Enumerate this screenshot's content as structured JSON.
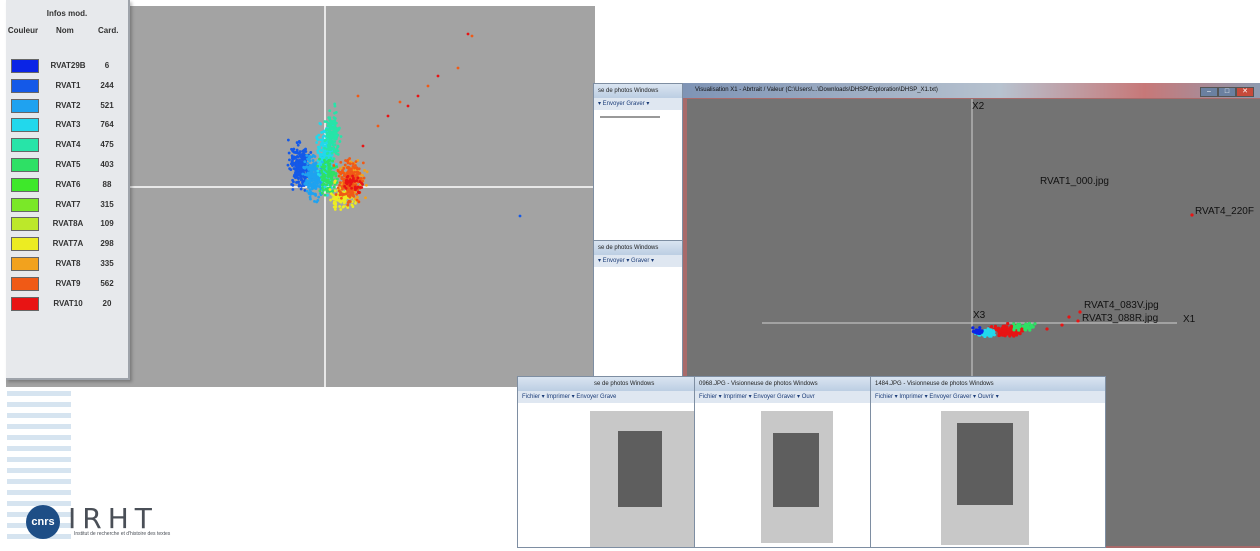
{
  "legend": {
    "title": "Infos mod.",
    "headers": {
      "color": "Couleur",
      "name": "Nom",
      "card": "Card."
    },
    "rows": [
      {
        "color": "#0a24e6",
        "name": "RVAT29B",
        "card": "6"
      },
      {
        "color": "#1459e8",
        "name": "RVAT1",
        "card": "244"
      },
      {
        "color": "#1fa2f0",
        "name": "RVAT2",
        "card": "521"
      },
      {
        "color": "#22d8ec",
        "name": "RVAT3",
        "card": "764"
      },
      {
        "color": "#27e4a8",
        "name": "RVAT4",
        "card": "475"
      },
      {
        "color": "#2ee065",
        "name": "RVAT5",
        "card": "403"
      },
      {
        "color": "#3ee82a",
        "name": "RVAT6",
        "card": "88"
      },
      {
        "color": "#7ae828",
        "name": "RVAT7",
        "card": "315"
      },
      {
        "color": "#bce82a",
        "name": "RVAT8A",
        "card": "109"
      },
      {
        "color": "#ecec22",
        "name": "RVAT7A",
        "card": "298"
      },
      {
        "color": "#f2a21e",
        "name": "RVAT8",
        "card": "335"
      },
      {
        "color": "#f05a16",
        "name": "RVAT9",
        "card": "562"
      },
      {
        "color": "#e81414",
        "name": "RVAT10",
        "card": "20"
      }
    ]
  },
  "viewer_windows": [
    {
      "title": "se de photos Windows",
      "menu": "▾  Envoyer  Graver ▾"
    },
    {
      "title": "se de photos Windows",
      "menu": "▾  Envoyer ▾  Graver ▾"
    },
    {
      "title": "se de photos Windows",
      "menu": "Fichier ▾  Imprimer ▾  Envoyer  Grave"
    },
    {
      "title": "0968.JPG - Visionneuse de photos Windows",
      "menu": "Fichier ▾  Imprimer ▾  Envoyer  Graver ▾  Ouvr"
    },
    {
      "title": "1484.JPG - Visionneuse de photos Windows",
      "menu": "Fichier ▾  Imprimer ▾  Envoyer  Graver ▾  Ouvrir ▾"
    }
  ],
  "visualisation": {
    "title": "Visualisation X1 - Abrtrait / Valeur (C:\\Users\\...\\Downloads\\DHSP\\Exploration\\DHSP_X1.txt)",
    "axis_x2": "X2",
    "axis_x1": "X1",
    "axis_x3": "X3",
    "labels": [
      "RVAT1_000.jpg",
      "RVAT4_220F",
      "RVAT4_083V.jpg",
      "RVAT3_088R.jpg"
    ]
  },
  "logo": {
    "cnrs": "cnrs",
    "irht": "IRHT",
    "subtitle": "Institut de recherche et d'histoire des textes"
  },
  "colors": {
    "plot_bg": "#a3a3a3",
    "vis_plot_bg": "#737373",
    "frame_red": "#a86a6a"
  }
}
